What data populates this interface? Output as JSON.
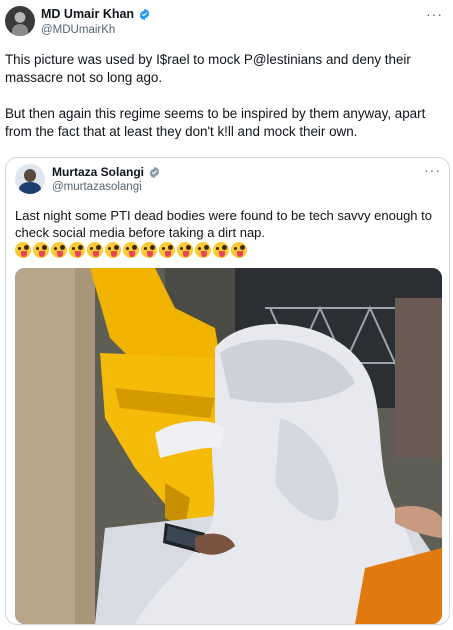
{
  "post": {
    "author": {
      "name": "MD Umair Khan",
      "handle": "@MDUmairKh",
      "verified": true
    },
    "text_paragraphs": [
      "This picture was used by I$rael to mock P@lestinians and deny their massacre not so long ago.",
      "But then again this regime seems to be inspired by them anyway, apart from the fact that at least they don't k!ll and mock their own."
    ],
    "more_icon": "ellipsis-icon"
  },
  "quote": {
    "author": {
      "name": "Murtaza Solangi",
      "handle": "@murtazasolangi",
      "verified": true
    },
    "text": "Last night some PTI dead bodies were found to be tech savvy enough to check social media before taking a dirt nap.",
    "emoji_name": "winking-face-with-tongue-emoji",
    "emoji_count": 13,
    "more_icon": "ellipsis-icon"
  },
  "colors": {
    "text_primary": "#0f1419",
    "text_secondary": "#536471",
    "verified_blue": "#1d9bf0",
    "border": "#cfd9de"
  }
}
